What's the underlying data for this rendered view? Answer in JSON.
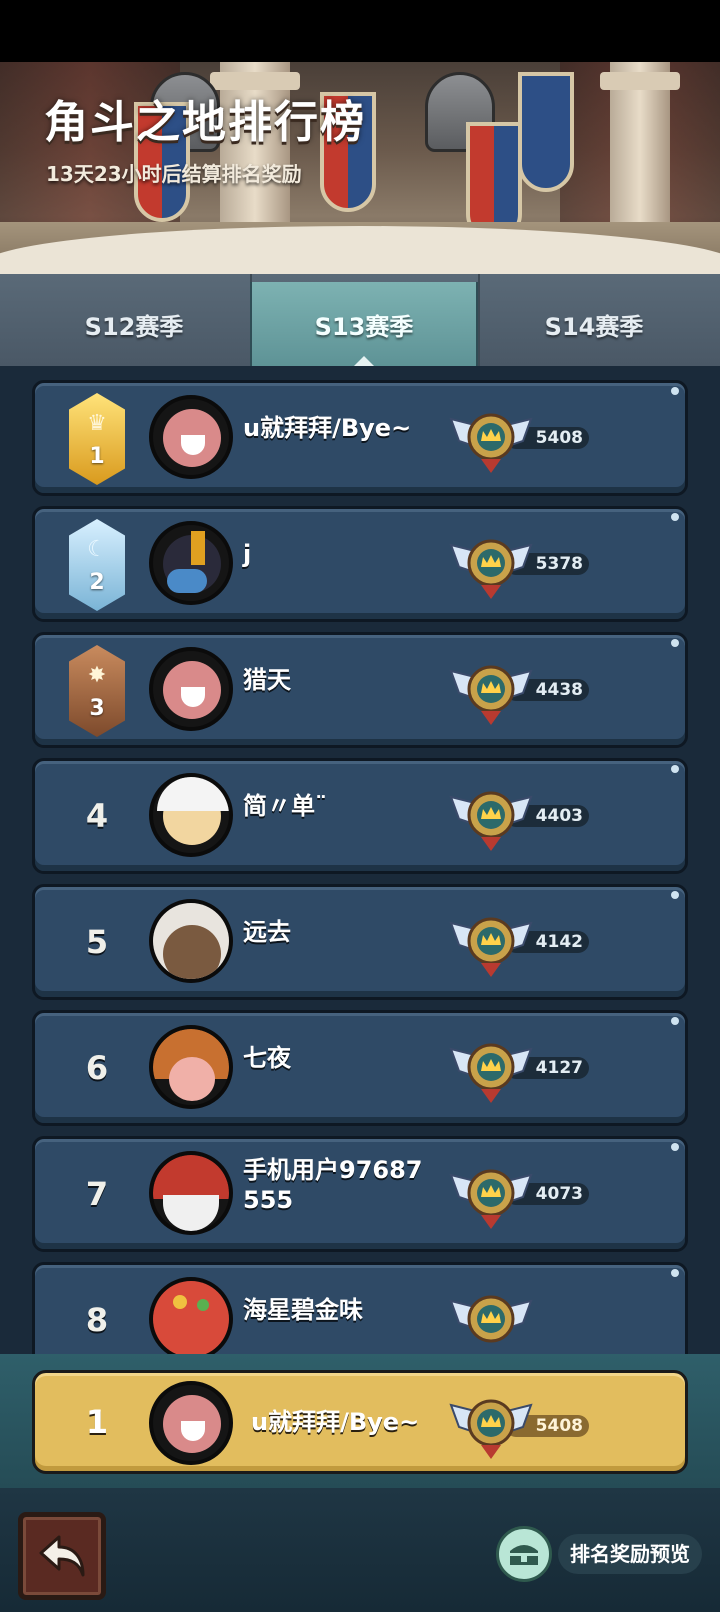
{
  "header": {
    "title": "角斗之地排行榜",
    "subtitle": "13天23小时后结算排名奖励"
  },
  "tabs": [
    {
      "label": "S12赛季",
      "active": false
    },
    {
      "label": "S13赛季",
      "active": true
    },
    {
      "label": "S14赛季",
      "active": false
    }
  ],
  "leaderboard": {
    "rows": [
      {
        "rank": "1",
        "medal": "gold",
        "name": "u就拜拜/Bye~",
        "score": "5408",
        "avatar_color": "#d98a8a"
      },
      {
        "rank": "2",
        "medal": "silver",
        "name": "j",
        "score": "5378",
        "avatar_color": "#4a6a9a"
      },
      {
        "rank": "3",
        "medal": "bronze",
        "name": "猎天",
        "score": "4438",
        "avatar_color": "#d98a8a"
      },
      {
        "rank": "4",
        "medal": "",
        "name": "简〃单¨",
        "score": "4403",
        "avatar_color": "#f2d6a0"
      },
      {
        "rank": "5",
        "medal": "",
        "name": "远去",
        "score": "4142",
        "avatar_color": "#7a5a40"
      },
      {
        "rank": "6",
        "medal": "",
        "name": "七夜",
        "score": "4127",
        "avatar_color": "#d88a3a"
      },
      {
        "rank": "7",
        "medal": "",
        "name": "手机用户97687555",
        "name_line1": "手机用户97687",
        "name_line2": "555",
        "score": "4073",
        "avatar_color": "#c23a2e"
      },
      {
        "rank": "8",
        "medal": "",
        "name": "海星碧金味",
        "score": "",
        "avatar_color": "#c23a2e"
      }
    ]
  },
  "self": {
    "rank": "1",
    "name": "u就拜拜/Bye~",
    "score": "5408"
  },
  "bottom": {
    "reward_preview_label": "排名奖励预览"
  },
  "colors": {
    "row_bg": "#2f4a66",
    "self_row_bg": "#e2bd5e",
    "active_tab": "#6fa3a5"
  },
  "icons": {
    "back": "back-arrow-icon",
    "reward": "reward-chest-icon",
    "rank_badge": "winged-crown-badge-icon"
  }
}
